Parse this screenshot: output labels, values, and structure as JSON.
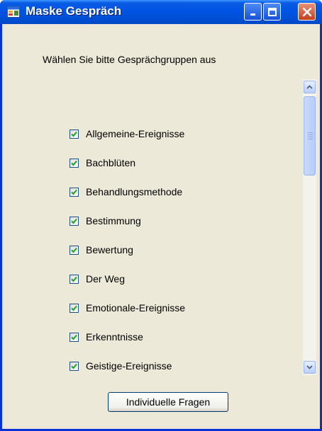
{
  "window": {
    "title": "Maske Gespräch"
  },
  "instruction": "Wählen Sie bitte Gesprächgruppen aus",
  "groups": [
    {
      "label": "Allgemeine-Ereignisse",
      "checked": true
    },
    {
      "label": "Bachblüten",
      "checked": true
    },
    {
      "label": "Behandlungsmethode",
      "checked": true
    },
    {
      "label": "Bestimmung",
      "checked": true
    },
    {
      "label": "Bewertung",
      "checked": true
    },
    {
      "label": "Der Weg",
      "checked": true
    },
    {
      "label": "Emotionale-Ereignisse",
      "checked": true
    },
    {
      "label": "Erkenntnisse",
      "checked": true
    },
    {
      "label": "Geistige-Ereignisse",
      "checked": true
    }
  ],
  "buttons": {
    "individual_questions": "Individuelle Fragen"
  },
  "colors": {
    "titlebar": "#0054e3",
    "window_bg": "#ece9d8",
    "check": "#21a121"
  }
}
